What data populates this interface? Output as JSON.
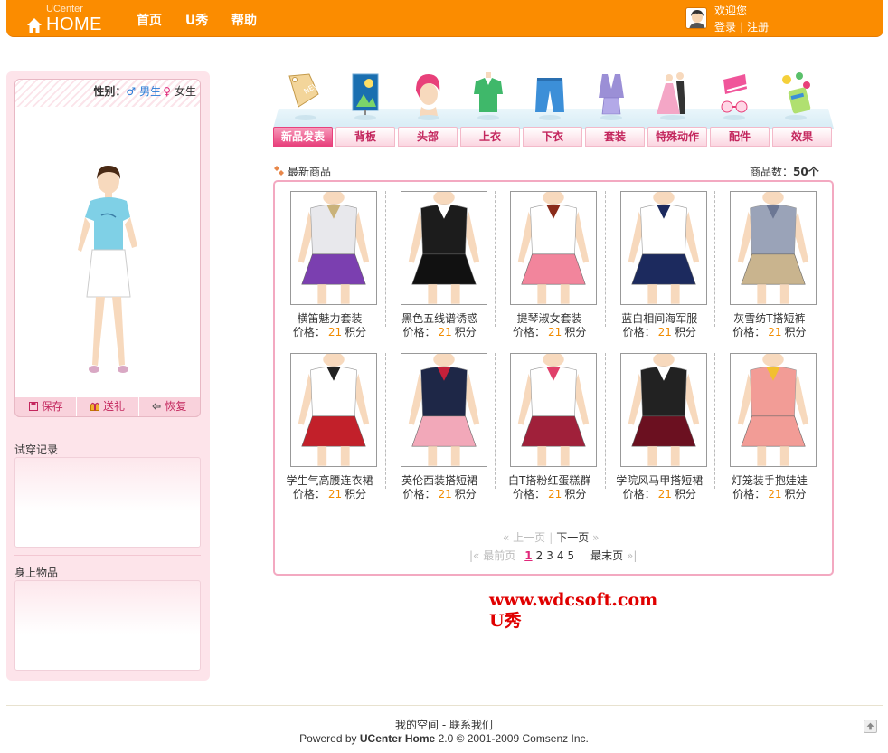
{
  "header": {
    "logo_small": "UCenter",
    "logo_big": "HOME",
    "nav": [
      "首页",
      "U秀",
      "帮助"
    ],
    "welcome": "欢迎您",
    "login": "登录",
    "register": "注册"
  },
  "sidebar": {
    "gender_label": "性别：",
    "male": "男生",
    "female": "女生",
    "buttons": [
      "保存",
      "送礼",
      "恢复"
    ],
    "history_title": "试穿记录",
    "worn_title": "身上物品"
  },
  "categories": [
    {
      "label": "新品发表",
      "icon": "new-tag-icon",
      "active": true
    },
    {
      "label": "背板",
      "icon": "backboard-icon",
      "active": false
    },
    {
      "label": "头部",
      "icon": "hair-icon",
      "active": false
    },
    {
      "label": "上衣",
      "icon": "shirt-icon",
      "active": false
    },
    {
      "label": "下衣",
      "icon": "pants-icon",
      "active": false
    },
    {
      "label": "套装",
      "icon": "suit-icon",
      "active": false
    },
    {
      "label": "特殊动作",
      "icon": "dance-icon",
      "active": false
    },
    {
      "label": "配件",
      "icon": "accessory-icon",
      "active": false
    },
    {
      "label": "效果",
      "icon": "effect-icon",
      "active": false
    }
  ],
  "list": {
    "title": "最新商品",
    "count_label": "商品数：",
    "count_value": "50个",
    "price_label": "价格：",
    "price_unit": "积分",
    "products": [
      {
        "name": "横笛魅力套装",
        "price": "21",
        "top": "#e8e8ec",
        "skirt": "#7b3fb0",
        "accent": "#c9b27a"
      },
      {
        "name": "黑色五线谱诱惑",
        "price": "21",
        "top": "#1c1c1c",
        "skirt": "#111111",
        "accent": "#ffffff"
      },
      {
        "name": "提琴淑女套装",
        "price": "21",
        "top": "#ffffff",
        "skirt": "#f2859c",
        "accent": "#8a2b1a"
      },
      {
        "name": "蓝白相间海军服",
        "price": "21",
        "top": "#ffffff",
        "skirt": "#1c2a5e",
        "accent": "#1c2a5e"
      },
      {
        "name": "灰雪纺T搭短裤",
        "price": "21",
        "top": "#9aa3b8",
        "skirt": "#c9b48e",
        "accent": "#6c7794"
      },
      {
        "name": "学生气高腰连衣裙",
        "price": "21",
        "top": "#ffffff",
        "skirt": "#c2202a",
        "accent": "#222222"
      },
      {
        "name": "英伦西装搭短裙",
        "price": "21",
        "top": "#1e2747",
        "skirt": "#f2a8b9",
        "accent": "#c4203a"
      },
      {
        "name": "白T搭粉红蛋糕群",
        "price": "21",
        "top": "#ffffff",
        "skirt": "#a0203a",
        "accent": "#e0406a"
      },
      {
        "name": "学院风马甲搭短裙",
        "price": "21",
        "top": "#222222",
        "skirt": "#6b1020",
        "accent": "#ffffff"
      },
      {
        "name": "灯笼装手抱娃娃",
        "price": "21",
        "top": "#f29c96",
        "skirt": "#f29c96",
        "accent": "#f2c030"
      }
    ]
  },
  "pager": {
    "prev": "上一页",
    "next": "下一页",
    "first": "最前页",
    "last": "最末页",
    "current": "1",
    "pages": [
      "2",
      "3",
      "4",
      "5"
    ]
  },
  "watermark": {
    "line1": "www.wdcsoft.com",
    "line2": "U秀"
  },
  "footer": {
    "links": "我的空间 - 联系我们",
    "powered": "Powered by",
    "product": "UCenter Home",
    "copyright": "2.0 © 2001-2009 Comsenz Inc."
  }
}
